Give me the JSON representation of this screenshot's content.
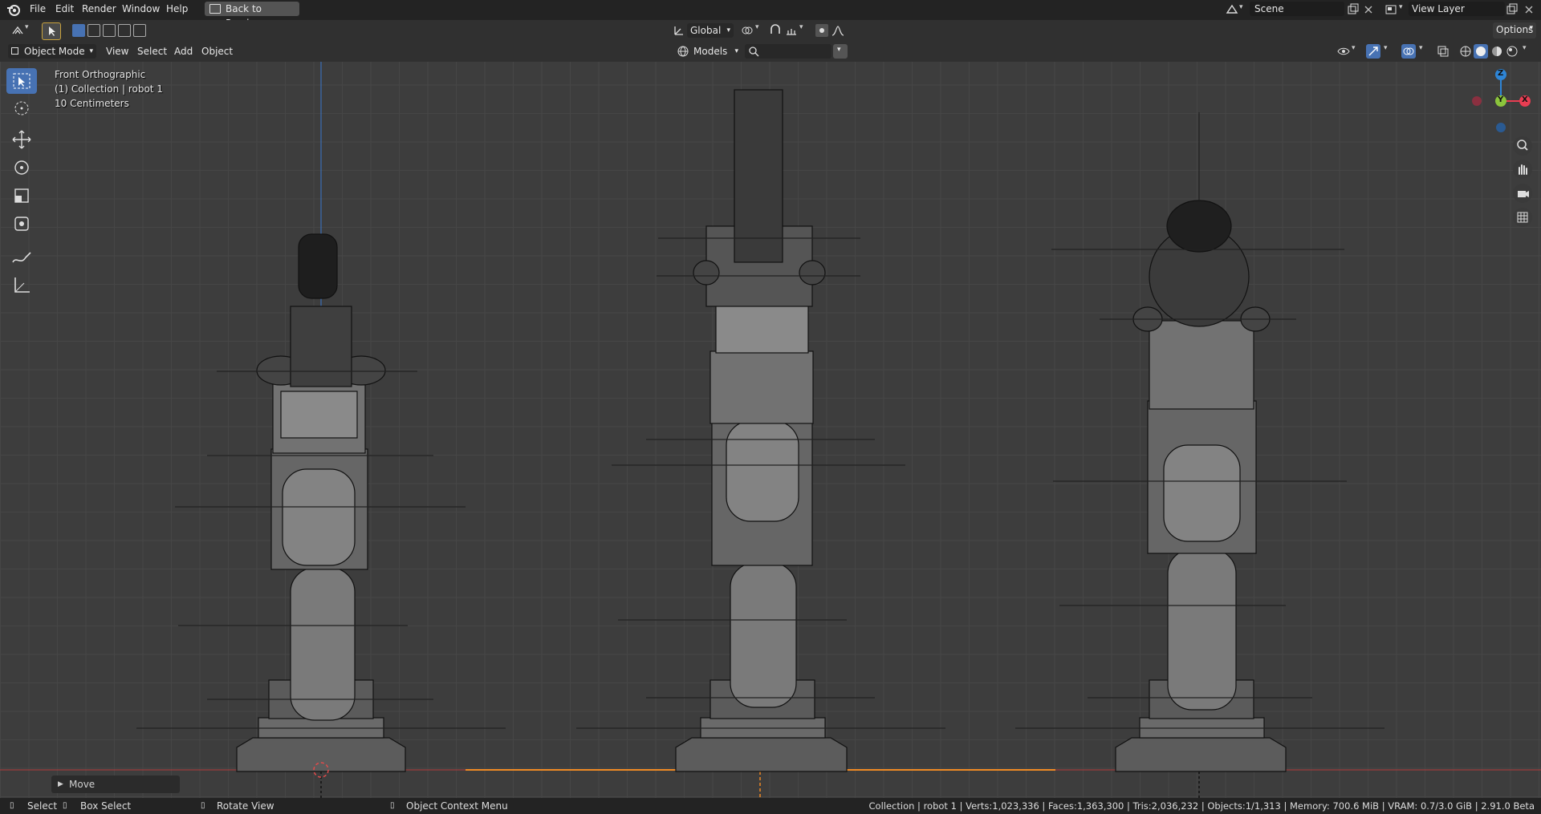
{
  "topbar": {
    "menus": [
      "File",
      "Edit",
      "Render",
      "Window",
      "Help"
    ],
    "back_button": "Back to Previous",
    "scene": "Scene",
    "view_layer": "View Layer"
  },
  "header": {
    "mode": "Object Mode",
    "menus": [
      "View",
      "Select",
      "Add",
      "Object"
    ],
    "transform_orientation": "Global",
    "collection_filter": "Models",
    "search_placeholder": "",
    "options": "Options"
  },
  "viewport": {
    "view_name": "Front Orthographic",
    "collection_info": "(1) Collection | robot 1",
    "scale": "10 Centimeters",
    "gizmo": {
      "z": "Z",
      "y": "Y",
      "x": "X"
    },
    "last_operator": "Move"
  },
  "statusbar": {
    "select": "Select",
    "box_select": "Box Select",
    "rotate_view": "Rotate View",
    "context_menu": "Object Context Menu",
    "stats": "Collection | robot 1 | Verts:1,023,336 | Faces:1,363,300 | Tris:2,036,232 | Objects:1/1,313 | Memory: 700.6 MiB | VRAM: 0.7/3.0 GiB | 2.91.0 Beta"
  },
  "colors": {
    "accent": "#4772b3",
    "x_axis": "#e83d52",
    "y_axis": "#8bc43c",
    "z_axis": "#2e85d6",
    "selection_orange": "#f08a24"
  }
}
